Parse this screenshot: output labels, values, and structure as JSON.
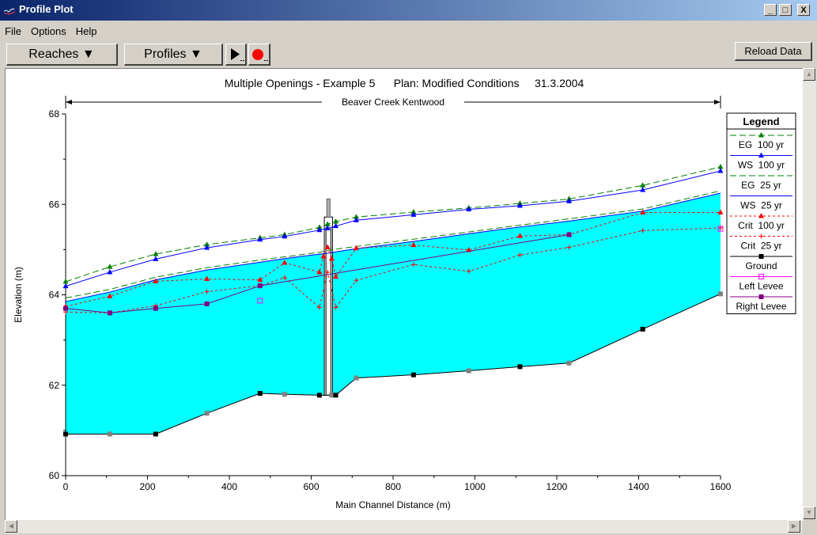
{
  "window": {
    "title": "Profile Plot"
  },
  "window_controls": {
    "minimize": "_",
    "maximize": "□",
    "close": "X"
  },
  "menu": [
    "File",
    "Options",
    "Help"
  ],
  "toolbar": {
    "reaches": "Reaches ▼",
    "profiles": "Profiles ▼",
    "reload": "Reload Data"
  },
  "plot": {
    "title": "Multiple Openings - Example 5      Plan: Modified Conditions     31.3.2004",
    "reach_label": "Beaver Creek Kentwood",
    "xlabel": "Main Channel Distance (m)",
    "ylabel": "Elevation (m)"
  },
  "legend": {
    "title": "Legend",
    "items": [
      {
        "label": "EG  100 yr",
        "color": "#008000",
        "marker": "triangle",
        "dash": "8,4"
      },
      {
        "label": "WS  100 yr",
        "color": "#0000ff",
        "marker": "triangle",
        "dash": ""
      },
      {
        "label": "EG  25 yr",
        "color": "#008000",
        "marker": "none",
        "dash": "8,4"
      },
      {
        "label": "WS  25 yr",
        "color": "#0000ff",
        "marker": "none",
        "dash": ""
      },
      {
        "label": "Crit  100 yr",
        "color": "#ff0000",
        "marker": "triangle",
        "dash": "3,3"
      },
      {
        "label": "Crit  25 yr",
        "color": "#ff0000",
        "marker": "plus",
        "dash": "3,3"
      },
      {
        "label": "Ground",
        "color": "#000000",
        "marker": "square",
        "dash": ""
      },
      {
        "label": "Left Levee",
        "color": "#ff00ff",
        "marker": "opensquare",
        "dash": ""
      },
      {
        "label": "Right Levee",
        "color": "#800080",
        "marker": "square",
        "dash": ""
      }
    ]
  },
  "chart_data": {
    "type": "line",
    "xlim": [
      0,
      1600
    ],
    "ylim": [
      60,
      68
    ],
    "xticks": [
      0,
      200,
      400,
      600,
      800,
      1000,
      1200,
      1400,
      1600
    ],
    "yticks": [
      60,
      62,
      64,
      66,
      68
    ],
    "water_fill_color": "#00ffff",
    "series": [
      {
        "name": "EG  100 yr",
        "color": "#008000",
        "dash": "8,4",
        "marker": "triangle",
        "x": [
          0,
          108,
          220,
          345,
          475,
          535,
          620,
          640,
          660,
          710,
          850,
          985,
          1110,
          1230,
          1410,
          1600
        ],
        "y": [
          64.29,
          64.62,
          64.9,
          65.11,
          65.26,
          65.33,
          65.49,
          65.56,
          65.62,
          65.72,
          65.83,
          65.92,
          66.02,
          66.12,
          66.42,
          66.83
        ]
      },
      {
        "name": "WS  100 yr",
        "color": "#0000ff",
        "dash": "",
        "marker": "triangle",
        "x": [
          0,
          108,
          220,
          345,
          475,
          535,
          620,
          640,
          660,
          710,
          850,
          985,
          1110,
          1230,
          1410,
          1600
        ],
        "y": [
          64.19,
          64.5,
          64.79,
          65.04,
          65.22,
          65.29,
          65.43,
          65.47,
          65.52,
          65.65,
          65.77,
          65.89,
          65.97,
          66.07,
          66.32,
          66.74
        ]
      },
      {
        "name": "EG  25 yr",
        "color": "#008000",
        "dash": "8,4",
        "marker": "none",
        "x": [
          0,
          108,
          220,
          345,
          475,
          535,
          620,
          640,
          660,
          710,
          850,
          985,
          1110,
          1230,
          1410,
          1600
        ],
        "y": [
          63.93,
          64.12,
          64.39,
          64.6,
          64.77,
          64.84,
          64.94,
          64.98,
          65.01,
          65.07,
          65.23,
          65.39,
          65.54,
          65.68,
          65.9,
          66.3
        ]
      },
      {
        "name": "WS  25 yr",
        "color": "#0000ff",
        "dash": "",
        "marker": "none",
        "x": [
          0,
          108,
          220,
          345,
          475,
          535,
          620,
          640,
          660,
          710,
          850,
          985,
          1110,
          1230,
          1410,
          1600
        ],
        "y": [
          63.85,
          64.06,
          64.33,
          64.55,
          64.72,
          64.8,
          64.9,
          64.92,
          64.95,
          65.02,
          65.18,
          65.35,
          65.5,
          65.63,
          65.85,
          66.25
        ]
      },
      {
        "name": "Crit  100 yr",
        "color": "#ff0000",
        "dash": "3,3",
        "marker": "triangle",
        "x": [
          0,
          108,
          220,
          345,
          475,
          535,
          620,
          630,
          640,
          650,
          660,
          710,
          850,
          985,
          1110,
          1230,
          1410,
          1600
        ],
        "y": [
          63.74,
          63.97,
          64.3,
          64.35,
          64.33,
          64.71,
          64.5,
          64.85,
          65.05,
          64.8,
          64.4,
          65.03,
          65.1,
          64.99,
          65.3,
          65.33,
          65.82,
          65.82
        ]
      },
      {
        "name": "Crit  25 yr",
        "color": "#ff0000",
        "dash": "3,3",
        "marker": "plus",
        "x": [
          0,
          108,
          220,
          345,
          475,
          535,
          620,
          640,
          660,
          710,
          850,
          985,
          1110,
          1230,
          1410,
          1600
        ],
        "y": [
          63.62,
          63.6,
          63.76,
          64.07,
          64.2,
          64.38,
          63.72,
          64.5,
          63.72,
          64.32,
          64.67,
          64.52,
          64.88,
          65.05,
          65.42,
          65.48
        ]
      },
      {
        "name": "Ground",
        "color": "#000000",
        "dash": "",
        "marker": "square",
        "x": [
          0,
          108,
          220,
          345,
          475,
          535,
          620,
          650,
          660,
          710,
          850,
          985,
          1110,
          1230,
          1410,
          1600
        ],
        "y": [
          60.92,
          60.92,
          60.92,
          61.38,
          61.82,
          61.8,
          61.78,
          61.78,
          61.78,
          62.16,
          62.23,
          62.32,
          62.41,
          62.49,
          63.24,
          64.02
        ]
      },
      {
        "name": "Left Levee",
        "color": "#ff00ff",
        "dash": "",
        "marker": "opensquare",
        "x": [
          475,
          1600
        ],
        "y": [
          63.87,
          65.46
        ]
      },
      {
        "name": "Right Levee",
        "color": "#800080",
        "dash": "",
        "marker": "square",
        "x": [
          0,
          108,
          220,
          345,
          475,
          1230
        ],
        "y": [
          63.7,
          63.6,
          63.7,
          63.8,
          64.2,
          65.33
        ]
      }
    ]
  }
}
